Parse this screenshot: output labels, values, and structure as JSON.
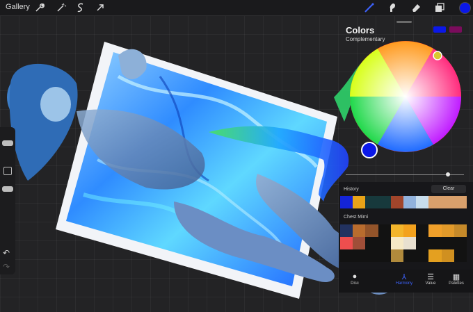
{
  "toolbar": {
    "gallery_label": "Gallery",
    "current_color": "#0b18e8"
  },
  "colors_panel": {
    "title": "Colors",
    "mode": "Complementary",
    "primary_color": "#0b18e8",
    "secondary_color": "#7a0c5c",
    "history_label": "History",
    "clear_label": "Clear",
    "palette_name": "Chest Mimi",
    "history_colors": [
      "#1424d8",
      "#e8a318",
      "#17393c",
      "#17393c",
      "#a1452b",
      "#91b2dc",
      "#c8ddec",
      "#d9a06c",
      "#d9a06c",
      "#d9a06c"
    ],
    "palette_colors": [
      "#223260",
      "#b96c2e",
      "#93542a",
      "#121212",
      "#f3b52b",
      "#f3a21e",
      "#121212",
      "#f0a02a",
      "#e29a2a",
      "#c68a2a",
      "#ee4e4e",
      "#a04e38",
      "#121212",
      "#121212",
      "#f6e9c6",
      "#e8e0d0",
      "#121212",
      "#121212",
      "#121212",
      "#121212",
      "#121212",
      "#121212",
      "#121212",
      "#121212",
      "#b08a3c",
      "#121212",
      "#121212",
      "#e4a020",
      "#d09020",
      "#121212"
    ],
    "tabs": [
      {
        "label": "Disc",
        "icon": "disc-icon"
      },
      {
        "label": "Harmony",
        "icon": "harmony-icon"
      },
      {
        "label": "Value",
        "icon": "value-icon"
      },
      {
        "label": "Palettes",
        "icon": "palettes-icon"
      }
    ],
    "active_tab": "Harmony"
  }
}
